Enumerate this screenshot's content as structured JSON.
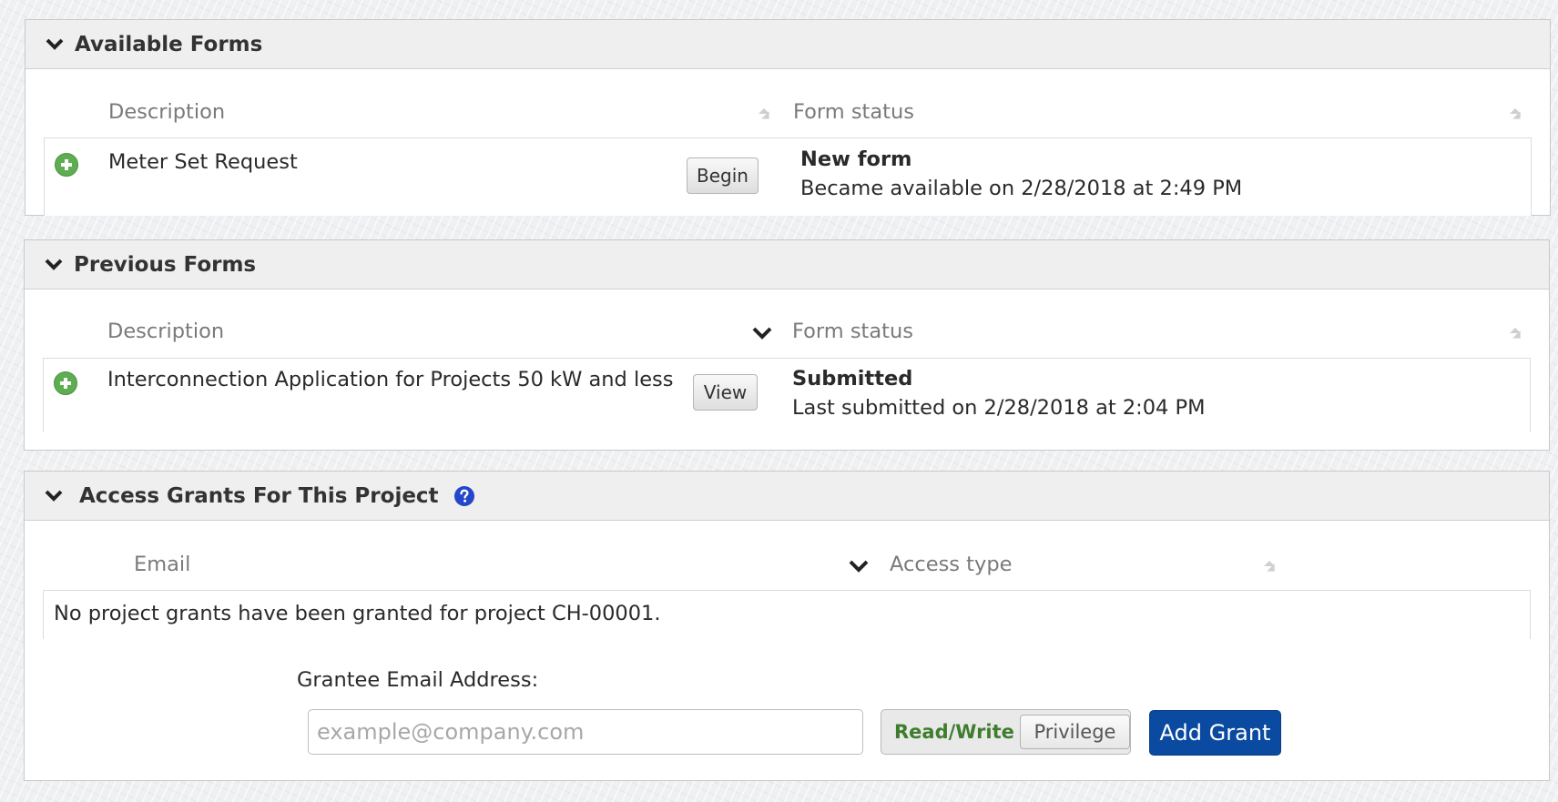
{
  "available_forms": {
    "title": "Available Forms",
    "col_description": "Description",
    "col_status": "Form status",
    "rows": [
      {
        "description": "Meter Set Request",
        "button": "Begin",
        "status_title": "New form",
        "status_detail": "Became available on 2/28/2018 at 2:49 PM"
      }
    ]
  },
  "previous_forms": {
    "title": "Previous Forms",
    "col_description": "Description",
    "col_status": "Form status",
    "rows": [
      {
        "description": "Interconnection Application for Projects 50 kW and less",
        "button": "View",
        "status_title": "Submitted",
        "status_detail": "Last submitted on 2/28/2018 at 2:04 PM"
      }
    ]
  },
  "access_grants": {
    "title": "Access Grants For This Project",
    "col_email": "Email",
    "col_access": "Access type",
    "empty_message": "No project grants have been granted for project CH-00001.",
    "grantee_label": "Grantee Email Address:",
    "email_placeholder": "example@company.com",
    "toggle_on": "Read/Write",
    "toggle_off": "Privilege",
    "add_button": "Add Grant"
  },
  "icons": {
    "collapse": "chevron-down-icon",
    "sort_unsorted": "sort-unsorted-icon",
    "sort_desc": "chevron-down-icon",
    "expand_row": "plus-circle-icon",
    "help": "question-circle-icon"
  },
  "colors": {
    "primary_button": "#0a4aa0",
    "add_icon": "#5fad52",
    "help_icon": "#2446c9",
    "toggle_active": "#3e7d2e"
  }
}
